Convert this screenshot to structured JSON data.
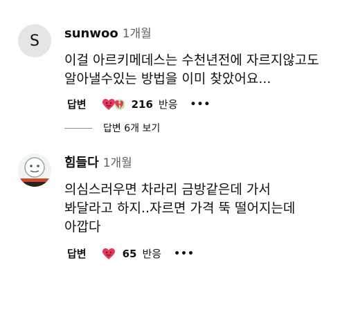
{
  "comments": [
    {
      "author": "sunwoo",
      "time": "1개월",
      "avatar_letter": "S",
      "text": "이걸 아르키메데스는 수천년전에 자르지않고도\n알아낼수있는 방법을 이미 찾았어요...",
      "reply_label": "답변",
      "reaction_count": "216",
      "reaction_label": "반응",
      "more": "•••",
      "replies_link": "답변 6개 보기",
      "reaction_icons": [
        "heart-face-icon",
        "cracked-heart-icon"
      ]
    },
    {
      "author": "힘들다",
      "time": "1개월",
      "text": "의심스러우면 차라리 금방같은데 가서\n봐달라고 하지..자르면 가격 뚝 떨어지는데\n아깝다",
      "reply_label": "답변",
      "reaction_count": "65",
      "reaction_label": "반응",
      "more": "•••",
      "reaction_icons": [
        "heart-face-icon"
      ]
    }
  ],
  "colors": {
    "text": "#0f0f0f",
    "secondary": "#606060",
    "heart": "#e8375a",
    "avatar_bg": "#e5e5e5"
  }
}
